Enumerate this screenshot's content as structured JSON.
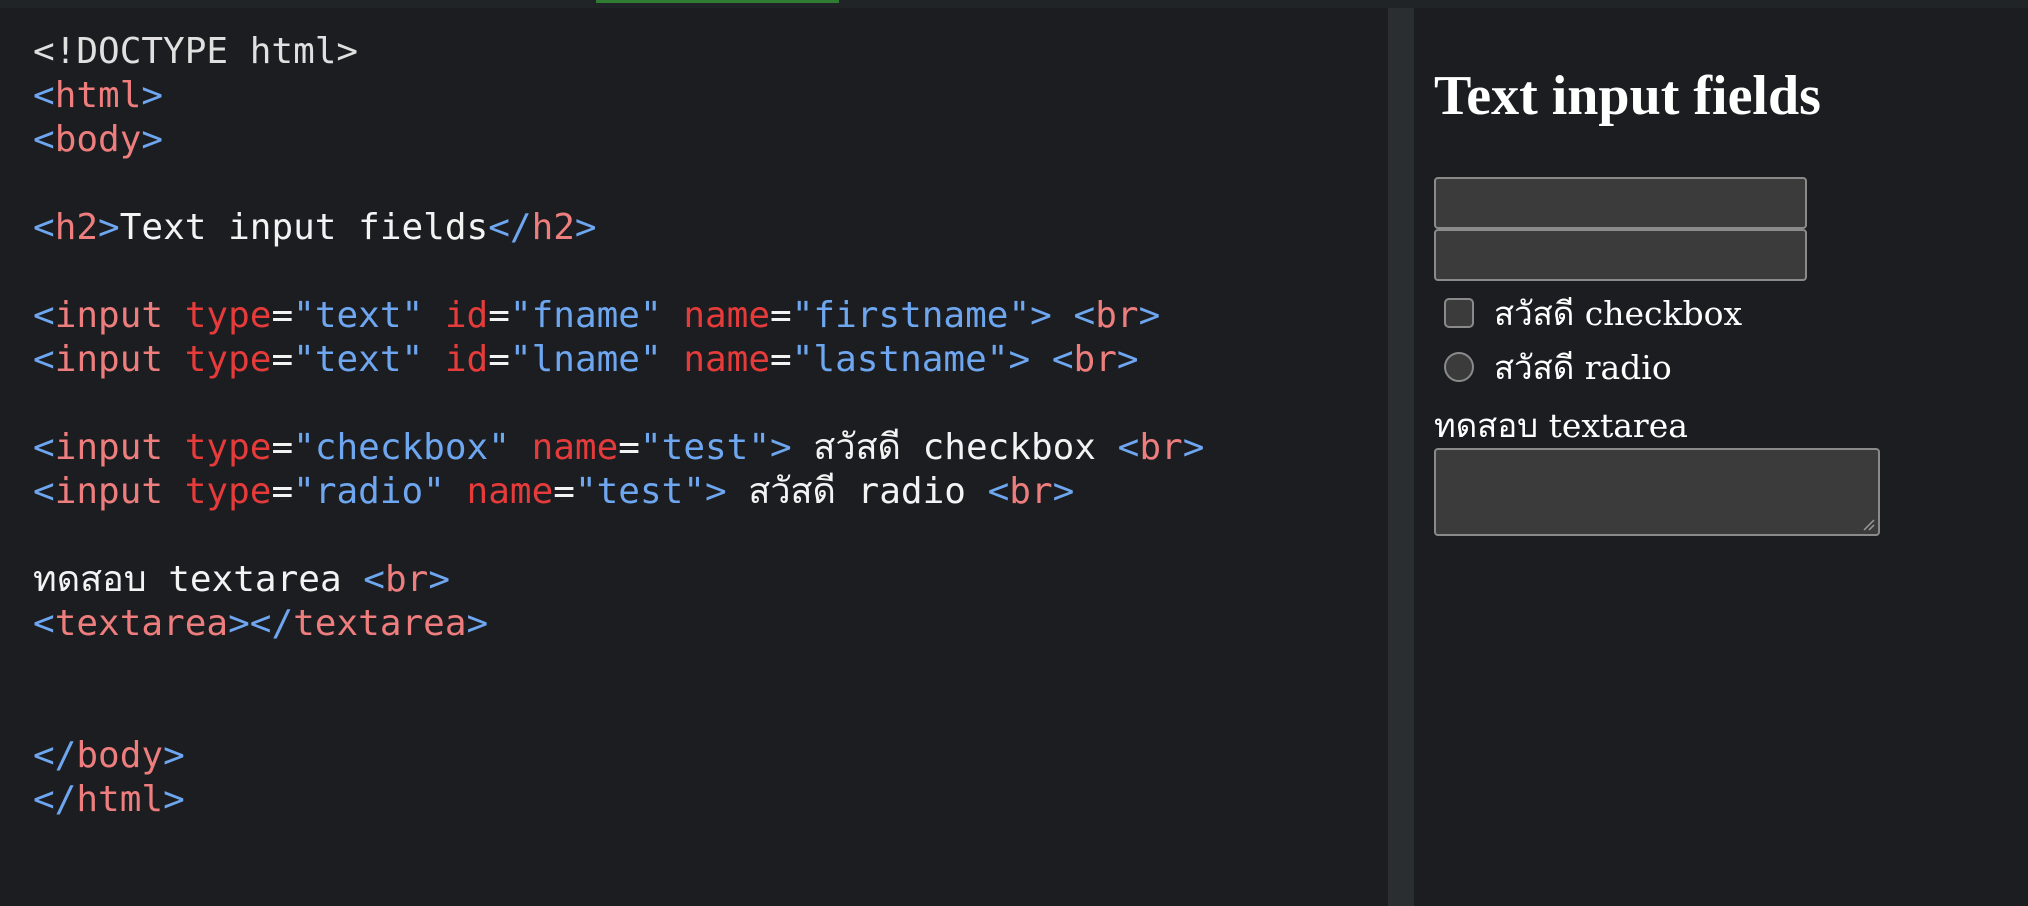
{
  "editor": {
    "lines": [
      {
        "type": "doctype",
        "text": "<!DOCTYPE html>"
      },
      {
        "type": "tag",
        "open": "<",
        "name": "html",
        "close": ">"
      },
      {
        "type": "tag",
        "open": "<",
        "name": "body",
        "close": ">"
      },
      {
        "type": "blank"
      },
      {
        "type": "h2",
        "open_tag": "h2",
        "content": "Text input fields",
        "close_tag": "h2"
      },
      {
        "type": "blank"
      },
      {
        "type": "input",
        "attrs": [
          [
            "type",
            "\"text\""
          ],
          [
            "id",
            "\"fname\""
          ],
          [
            "name",
            "\"firstname\""
          ]
        ],
        "after": " ",
        "br": "br"
      },
      {
        "type": "input",
        "attrs": [
          [
            "type",
            "\"text\""
          ],
          [
            "id",
            "\"lname\""
          ],
          [
            "name",
            "\"lastname\""
          ]
        ],
        "after": " ",
        "br": "br"
      },
      {
        "type": "blank"
      },
      {
        "type": "input",
        "attrs": [
          [
            "type",
            "\"checkbox\""
          ],
          [
            "name",
            "\"test\""
          ]
        ],
        "after": " สวัสดี checkbox ",
        "br": "br"
      },
      {
        "type": "input",
        "attrs": [
          [
            "type",
            "\"radio\""
          ],
          [
            "name",
            "\"test\""
          ]
        ],
        "after": " สวัสดี radio ",
        "br": "br"
      },
      {
        "type": "blank"
      },
      {
        "type": "textbr",
        "text": "ทดสอบ textarea ",
        "br": "br"
      },
      {
        "type": "pair",
        "name": "textarea"
      },
      {
        "type": "blank"
      },
      {
        "type": "blank"
      },
      {
        "type": "closetag",
        "name": "body"
      },
      {
        "type": "closetag",
        "name": "html"
      }
    ]
  },
  "preview": {
    "title": "Text input fields",
    "checkbox_label": "สวัสดี checkbox",
    "radio_label": "สวัสดี radio",
    "textarea_label": "ทดสอบ textarea"
  },
  "colors": {
    "editor_bg": "#1b1d20",
    "tag_bracket": "#6ea6f0",
    "tag_name": "#ee7d7d",
    "attr_name": "#e63b3b",
    "attr_value": "#6ea6f0",
    "input_bg": "#3b3b3b"
  }
}
